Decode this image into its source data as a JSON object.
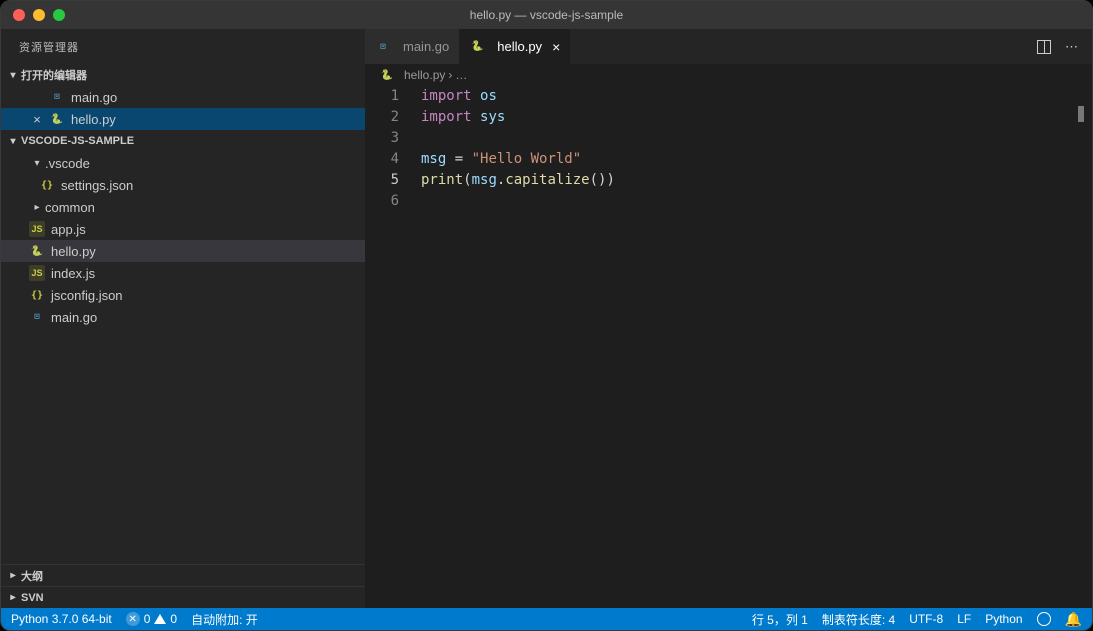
{
  "window": {
    "title": "hello.py — vscode-js-sample"
  },
  "sidebar": {
    "header": "资源管理器",
    "openEditors": {
      "label": "打开的编辑器",
      "items": [
        {
          "name": "main.go",
          "icon": "go"
        },
        {
          "name": "hello.py",
          "icon": "py",
          "close": true
        }
      ]
    },
    "folder": {
      "name": "VSCODE-JS-SAMPLE",
      "tree": [
        {
          "label": ".vscode",
          "type": "dir",
          "expanded": true
        },
        {
          "label": "settings.json",
          "type": "json",
          "indent": 2
        },
        {
          "label": "common",
          "type": "dir",
          "expanded": false
        },
        {
          "label": "app.js",
          "type": "js",
          "indent": 1
        },
        {
          "label": "hello.py",
          "type": "py",
          "indent": 1,
          "active": true
        },
        {
          "label": "index.js",
          "type": "js",
          "indent": 1
        },
        {
          "label": "jsconfig.json",
          "type": "json",
          "indent": 1
        },
        {
          "label": "main.go",
          "type": "go",
          "indent": 1
        }
      ]
    },
    "bottom": [
      {
        "label": "大纲"
      },
      {
        "label": "SVN"
      }
    ]
  },
  "tabs": [
    {
      "label": "main.go",
      "icon": "go",
      "active": false
    },
    {
      "label": "hello.py",
      "icon": "py",
      "active": true
    }
  ],
  "breadcrumb": {
    "file": "hello.py",
    "more": "…"
  },
  "code": {
    "lines": [
      "1",
      "2",
      "3",
      "4",
      "5",
      "6"
    ],
    "currentLine": 5,
    "l1_kw": "import",
    "l1_mod": "os",
    "l2_kw": "import",
    "l2_mod": "sys",
    "l4_var": "msg",
    "l4_eq": " = ",
    "l4_str": "\"Hello World\"",
    "l5_fn": "print",
    "l5_open": "(",
    "l5_var": "msg",
    "l5_dot": ".",
    "l5_m": "capitalize",
    "l5_call": "()",
    "l5_close": ")"
  },
  "status": {
    "python": "Python 3.7.0 64-bit",
    "errors": "0",
    "warnings": "0",
    "attach": "自动附加: 开",
    "linecol": "行 5，列 1",
    "tabsize": "制表符长度: 4",
    "encoding": "UTF-8",
    "eol": "LF",
    "lang": "Python"
  }
}
